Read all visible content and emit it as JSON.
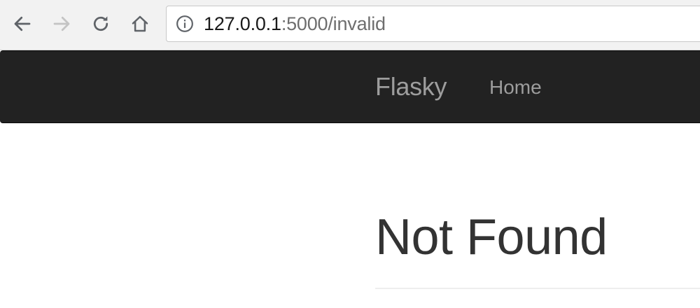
{
  "browser": {
    "url_host": "127.0.0.1",
    "url_rest": ":5000/invalid",
    "icons": {
      "back": "back-arrow-icon",
      "forward": "forward-arrow-icon",
      "reload": "reload-icon",
      "home": "home-icon",
      "info": "info-icon"
    }
  },
  "navbar": {
    "brand": "Flasky",
    "links": [
      {
        "label": "Home"
      }
    ],
    "background": "#222222",
    "link_color": "#9d9d9d"
  },
  "page": {
    "title": "Not Found",
    "title_color": "#333333"
  }
}
